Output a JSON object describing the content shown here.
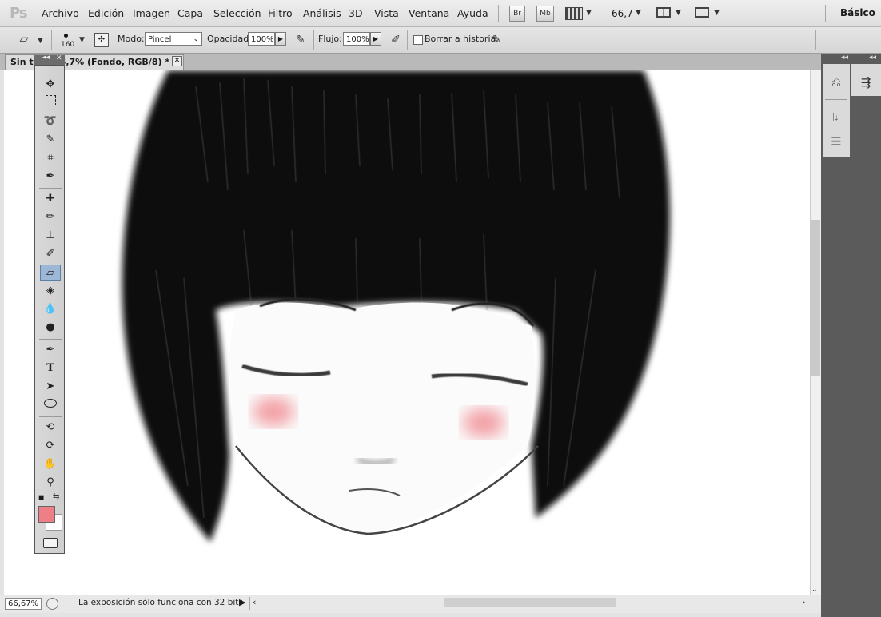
{
  "app": {
    "logo": "Ps",
    "workspace": "Básico"
  },
  "menu": [
    "Archivo",
    "Edición",
    "Imagen",
    "Capa",
    "Selección",
    "Filtro",
    "Análisis",
    "3D",
    "Vista",
    "Ventana",
    "Ayuda"
  ],
  "appbar": {
    "bridge_label": "Br",
    "minibridge_label": "Mb",
    "zoom_value": "66,7"
  },
  "options": {
    "brush_size": "160",
    "mode_label": "Modo:",
    "mode_value": "Pincel",
    "opacity_label": "Opacidad:",
    "opacity_value": "100%",
    "flow_label": "Flujo:",
    "flow_value": "100%",
    "erase_history_label": "Borrar a historia"
  },
  "document": {
    "tab_title": "Sin tít... 66,7% (Fondo, RGB/8) *"
  },
  "status": {
    "zoom": "66,67%",
    "message": "La exposición sólo funciona con 32 bits"
  },
  "colors": {
    "foreground": "#ef7f86",
    "background": "#ffffff",
    "active_tool": "#9cb8d6"
  },
  "tools": [
    "move-icon",
    "marquee-icon",
    "lasso-icon",
    "quick-selection-icon",
    "crop-icon",
    "eyedropper-icon",
    "healing-brush-icon",
    "brush-icon",
    "clone-stamp-icon",
    "history-brush-icon",
    "eraser-icon",
    "paint-bucket-icon",
    "blur-icon",
    "dodge-icon",
    "pen-icon",
    "type-icon",
    "path-selection-icon",
    "shape-icon",
    "3d-rotate-icon",
    "3d-orbit-icon",
    "hand-icon",
    "zoom-icon"
  ]
}
